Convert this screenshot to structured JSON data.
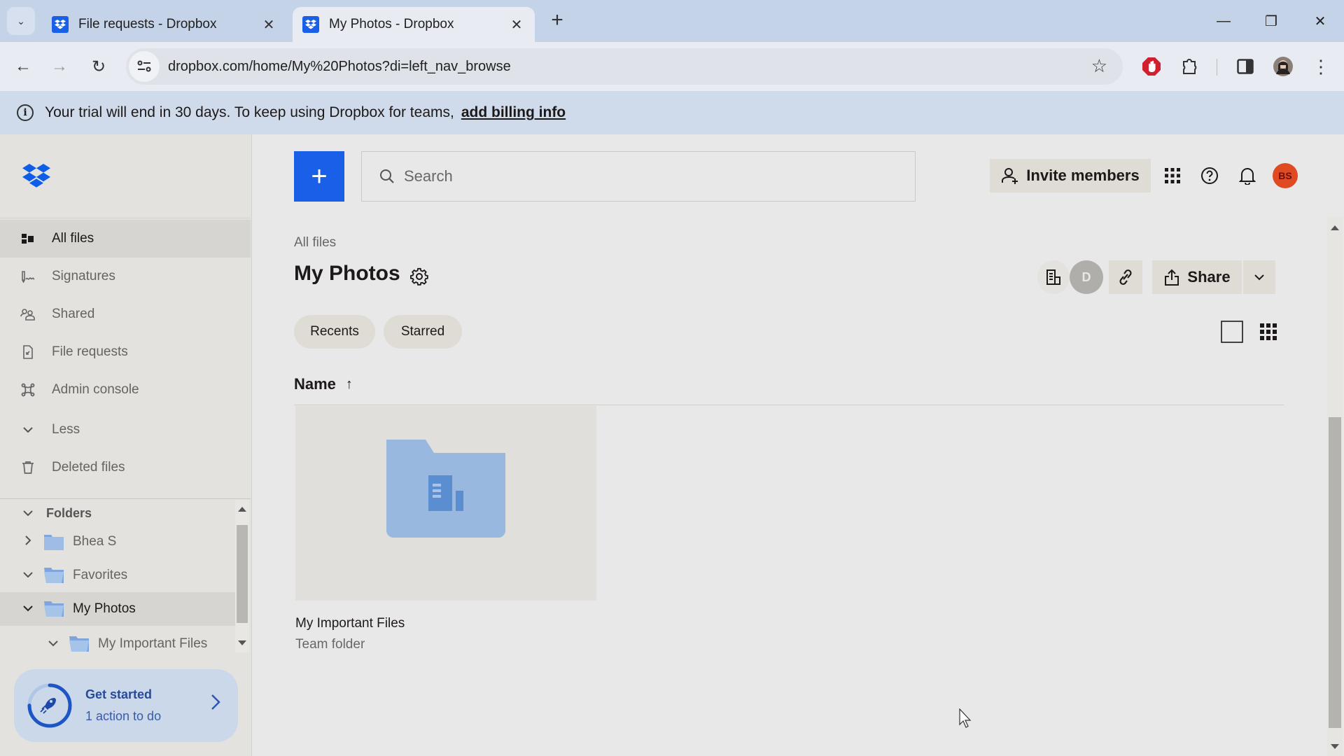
{
  "browser": {
    "tabs": [
      {
        "title": "File requests - Dropbox",
        "active": false
      },
      {
        "title": "My Photos - Dropbox",
        "active": true
      }
    ],
    "url": "dropbox.com/home/My%20Photos?di=left_nav_browse",
    "icons": {
      "tab_search": "chevron-down-icon",
      "new_tab": "plus-icon",
      "back": "arrow-left-icon",
      "forward": "arrow-right-icon",
      "reload": "reload-icon",
      "bookmark": "star-icon",
      "adblock": "stop-hand-icon",
      "extensions": "puzzle-icon",
      "side_panel": "side-panel-icon",
      "menu": "kebab-icon"
    },
    "glyphs": {
      "tab_search": "⌄",
      "close": "✕",
      "new_tab": "+",
      "back": "←",
      "forward": "→",
      "reload": "↻",
      "star": "☆",
      "minimize": "—",
      "restore": "❐",
      "close_window": "✕",
      "menu": "⋮"
    }
  },
  "banner": {
    "message": "Your trial will end in 30 days. To keep using Dropbox for teams,",
    "link": "add billing info",
    "info_glyph": "i"
  },
  "sidebar": {
    "nav": [
      {
        "label": "All files",
        "icon": "all-files-icon",
        "selected": true
      },
      {
        "label": "Signatures",
        "icon": "signature-icon",
        "selected": false
      },
      {
        "label": "Shared",
        "icon": "shared-icon",
        "selected": false
      },
      {
        "label": "File requests",
        "icon": "file-request-icon",
        "selected": false
      },
      {
        "label": "Admin console",
        "icon": "admin-console-icon",
        "selected": false
      },
      {
        "label": "Less",
        "icon": "chevron-down-icon",
        "selected": false
      },
      {
        "label": "Deleted files",
        "icon": "trash-icon",
        "selected": false
      }
    ],
    "folders_header": "Folders",
    "folders": [
      {
        "label": "Bhea S",
        "expanded": false,
        "depth": 0,
        "selected": false
      },
      {
        "label": "Favorites",
        "expanded": true,
        "depth": 0,
        "selected": false
      },
      {
        "label": "My Photos",
        "expanded": true,
        "depth": 0,
        "selected": true
      },
      {
        "label": "My Important Files",
        "expanded": true,
        "depth": 1,
        "selected": false
      }
    ],
    "get_started": {
      "title": "Get started",
      "subtitle": "1 action to do",
      "progress": 0.75
    }
  },
  "header": {
    "create_glyph": "+",
    "search_placeholder": "Search",
    "invite_label": "Invite members",
    "avatar_initials": "BS",
    "colors": {
      "brand_blue": "#1a5fe8",
      "avatar_bg": "#e04a22"
    }
  },
  "content": {
    "breadcrumb": "All files",
    "title": "My Photos",
    "member_initial": "D",
    "share_label": "Share",
    "chips": [
      "Recents",
      "Starred"
    ],
    "sort_column": "Name",
    "sort_glyph": "↑",
    "items": [
      {
        "name": "My Important Files",
        "subtitle": "Team folder",
        "type": "team-folder"
      }
    ]
  }
}
